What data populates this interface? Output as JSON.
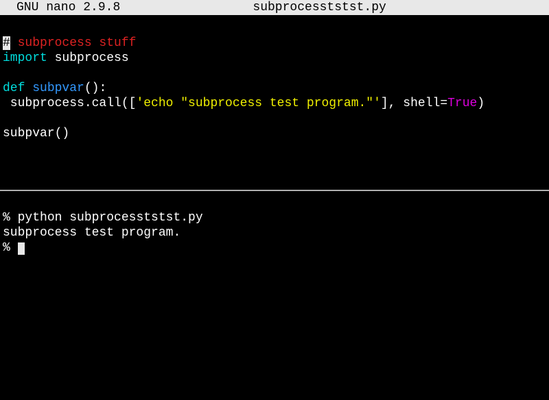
{
  "titlebar": {
    "app": "GNU nano",
    "version": "2.9.8",
    "filename": "subprocesststst.py"
  },
  "editor": {
    "line1": {
      "hash": "#",
      "comment": " subprocess stuff"
    },
    "line2": {
      "kw": "import",
      "mod": " subprocess"
    },
    "line4": {
      "def": "def ",
      "fn": "subpvar",
      "rest": "():"
    },
    "line5": {
      "pre": " subprocess.call([",
      "str": "'echo \"subprocess test program.\"'",
      "mid": "], shell=",
      "true": "True",
      "end": ")"
    },
    "line7": "subpvar()"
  },
  "terminal": {
    "prompt1": "% ",
    "cmd1": "python subprocesststst.py",
    "out1": "subprocess test program.",
    "prompt2": "% "
  }
}
